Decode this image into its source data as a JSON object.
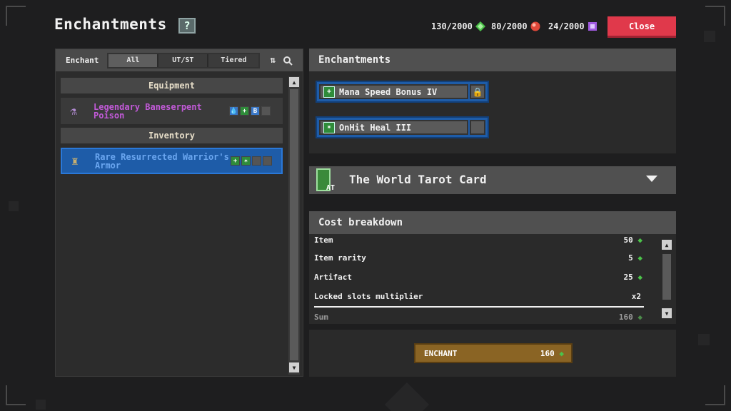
{
  "header": {
    "title": "Enchantments",
    "help_icon": "?",
    "close_label": "Close",
    "resources": [
      {
        "value": "130/2000",
        "icon": "green-gem-icon",
        "color": "#4cc24a"
      },
      {
        "value": "80/2000",
        "icon": "red-gem-icon",
        "color": "#e0483a"
      },
      {
        "value": "24/2000",
        "icon": "purple-gem-icon",
        "color": "#a05ae0"
      }
    ]
  },
  "left": {
    "filter_label": "Enchant",
    "tabs": [
      "All",
      "UT/ST",
      "Tiered"
    ],
    "sections": {
      "equipment": "Equipment",
      "inventory": "Inventory"
    },
    "items": [
      {
        "name": "Legendary Baneserpent Poison",
        "color": "#c25ad8"
      },
      {
        "name": "Rare Resurrected Warrior's Armor",
        "color": "#6aa6f0"
      }
    ]
  },
  "enchantments": {
    "title": "Enchantments",
    "list": [
      {
        "name": "Mana Speed Bonus IV",
        "locked": true
      },
      {
        "name": "OnHit Heal III",
        "locked": false
      }
    ]
  },
  "artifact": {
    "name": "The World Tarot Card",
    "badge": "AT"
  },
  "cost": {
    "title": "Cost breakdown",
    "rows": [
      {
        "label": "Item",
        "value": "50"
      },
      {
        "label": "Item rarity",
        "value": "5"
      },
      {
        "label": "Artifact",
        "value": "25"
      },
      {
        "label": "Locked slots multiplier",
        "value": "x2"
      },
      {
        "label": "Sum",
        "value": "160"
      }
    ]
  },
  "enchant_button": {
    "label": "ENCHANT",
    "cost": "160"
  }
}
